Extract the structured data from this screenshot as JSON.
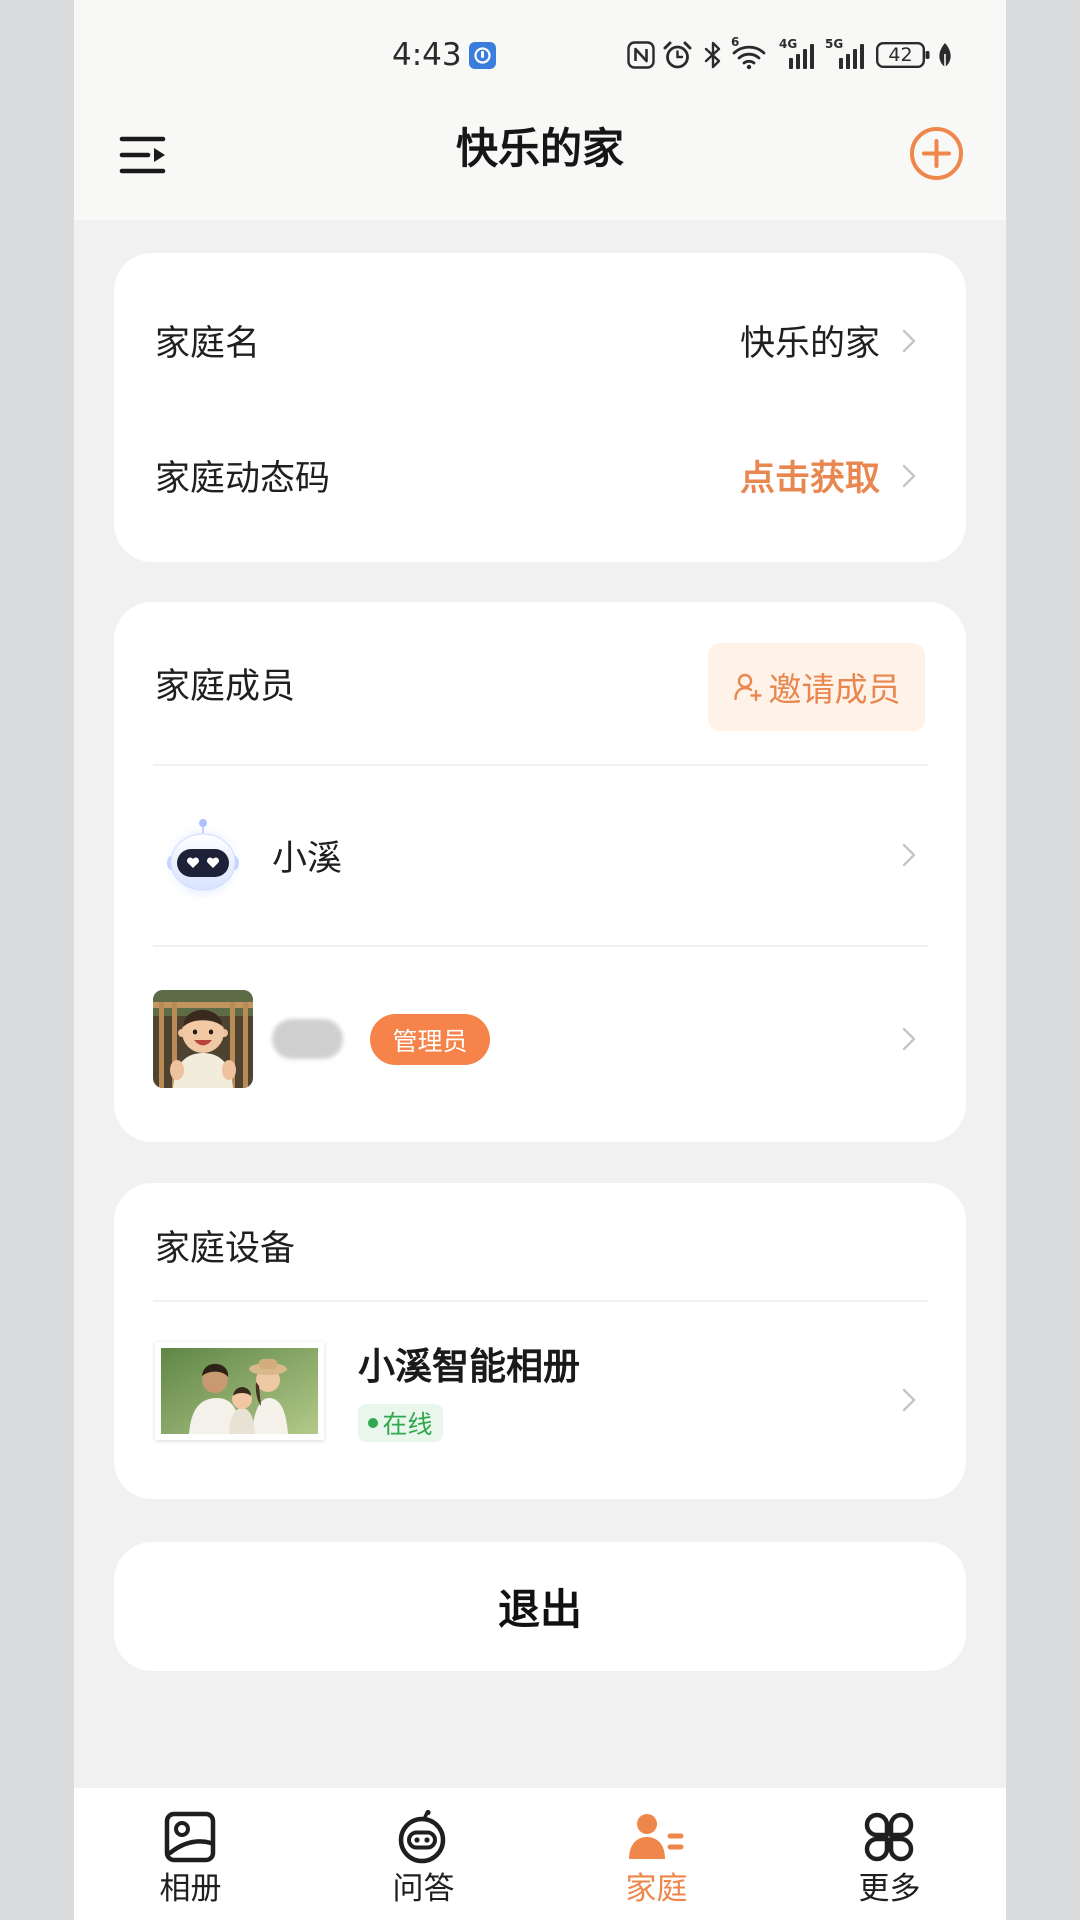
{
  "status_bar": {
    "time": "4:43",
    "wifi_label": "6",
    "network_1": "4G",
    "network_2": "5G",
    "battery": "42"
  },
  "header": {
    "title": "快乐的家",
    "left_icon": "menu-icon",
    "right_icon": "add-circle-icon"
  },
  "family_info": {
    "name_label": "家庭名",
    "name_value": "快乐的家",
    "code_label": "家庭动态码",
    "code_value": "点击获取"
  },
  "members": {
    "title": "家庭成员",
    "invite_label": "邀请成员",
    "items": [
      {
        "name": "小溪",
        "avatar": "robot-avatar"
      },
      {
        "badge": "管理员",
        "avatar": "baby-photo-avatar"
      }
    ]
  },
  "devices": {
    "title": "家庭设备",
    "items": [
      {
        "name": "小溪智能相册",
        "status": "在线"
      }
    ]
  },
  "logout": {
    "label": "退出"
  },
  "bottom_nav": {
    "items": [
      {
        "label": "相册",
        "icon": "photo-album-icon",
        "active": false
      },
      {
        "label": "问答",
        "icon": "robot-icon",
        "active": false
      },
      {
        "label": "家庭",
        "icon": "family-icon",
        "active": true
      },
      {
        "label": "更多",
        "icon": "more-grid-icon",
        "active": false
      }
    ]
  },
  "colors": {
    "accent": "#F0874A",
    "admin_badge": "#F5834A",
    "online": "#2FA84F",
    "background": "#F1F1F1"
  }
}
